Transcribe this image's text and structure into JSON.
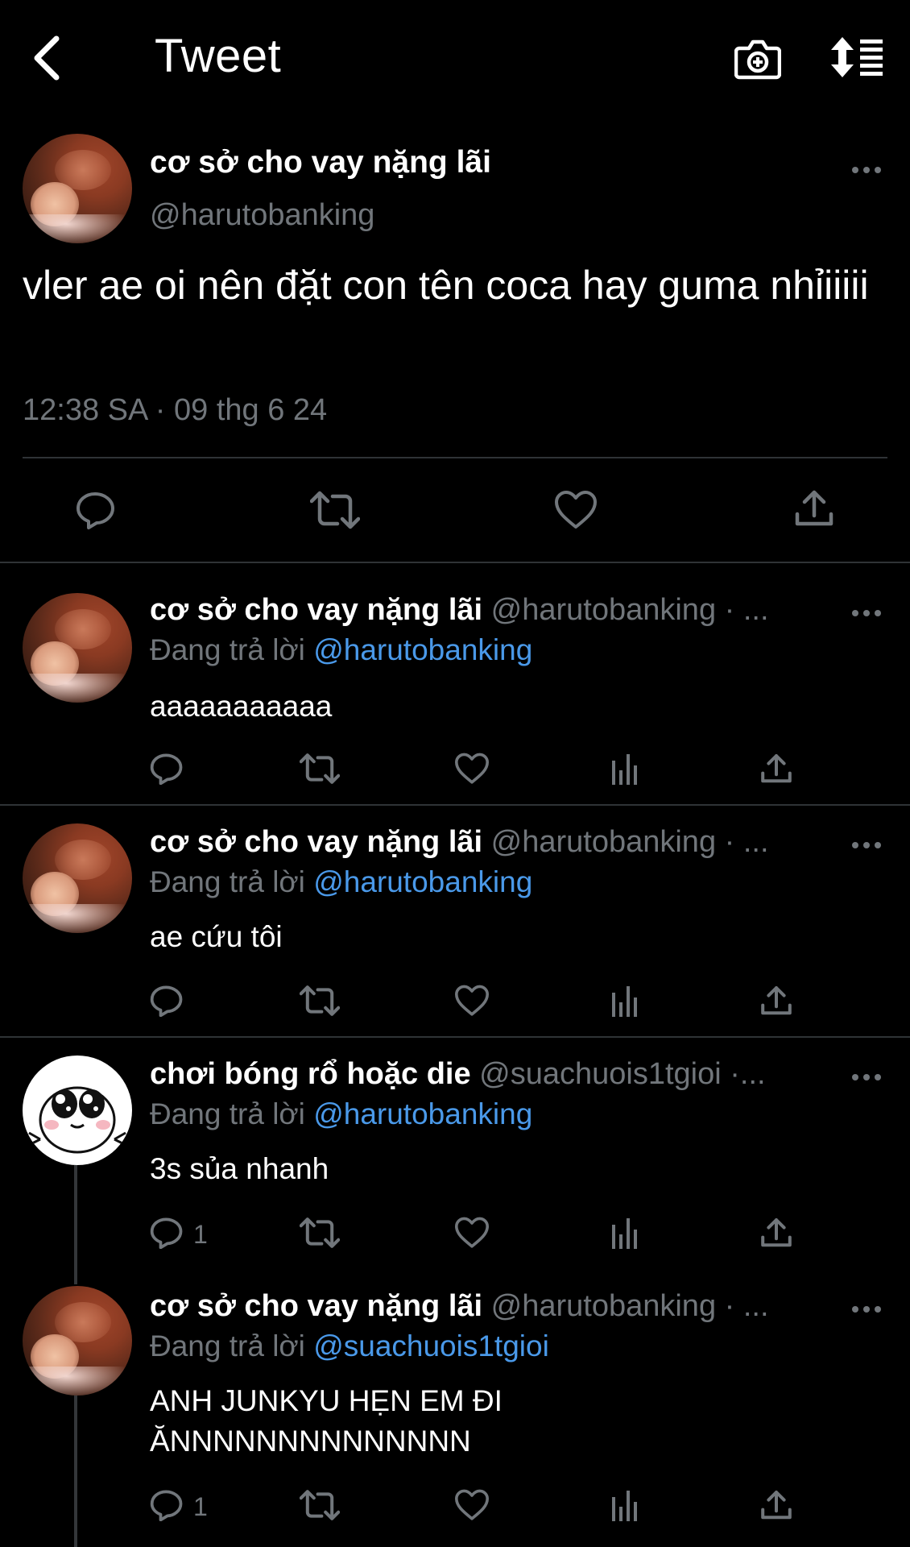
{
  "header": {
    "title": "Tweet",
    "back_icon": "chevron-left-icon",
    "camera_icon": "camera-plus-icon",
    "sort_icon": "sort-lines-icon"
  },
  "main_tweet": {
    "display_name": "cơ sở cho vay nặng lãi",
    "handle": "@harutobanking",
    "text": "vler ae oi nên đặt con tên coca hay guma nhỉiiiii",
    "timestamp": "12:38 SA · 09 thg 6 24"
  },
  "replies": [
    {
      "display_name": "cơ sở cho vay nặng lãi",
      "handle": "@harutobanking · ...",
      "replying_label": "Đang trả lời",
      "replying_to": "@harutobanking",
      "text": "aaaaaaaaaaa",
      "reply_count": ""
    },
    {
      "display_name": "cơ sở cho vay nặng lãi",
      "handle": "@harutobanking · ...",
      "replying_label": "Đang trả lời",
      "replying_to": "@harutobanking",
      "text": "ae cứu tôi",
      "reply_count": ""
    },
    {
      "display_name": "chơi bóng rổ hoặc die",
      "handle": "@suachuois1tgioi ·...",
      "replying_label": "Đang trả lời",
      "replying_to": "@harutobanking",
      "text": "3s sủa nhanh",
      "reply_count": "1"
    },
    {
      "display_name": "cơ sở cho vay nặng lãi",
      "handle": "@harutobanking · ...",
      "replying_label": "Đang trả lời",
      "replying_to": "@suachuois1tgioi",
      "text_line1": "ANH JUNKYU HẸN EM ĐI",
      "text_line2": "ĂNNNNNNNNNNNNNN",
      "reply_count": "1"
    }
  ],
  "colors": {
    "background": "#000000",
    "secondary_text": "#71767b",
    "mention": "#4a99e9",
    "divider": "#2f3336"
  }
}
